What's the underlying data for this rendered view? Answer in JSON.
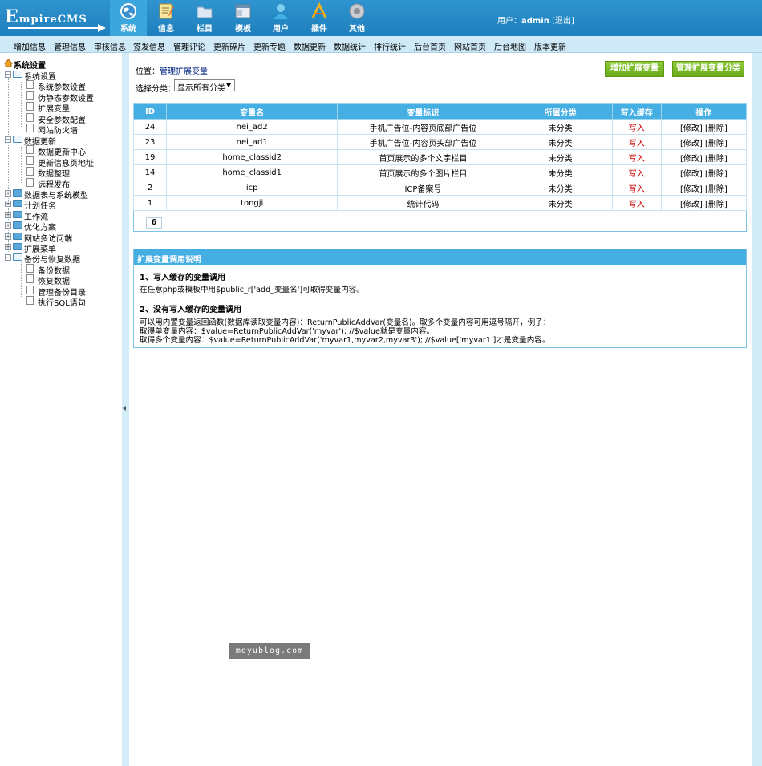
{
  "app": {
    "logo_text": "EmpireCMS"
  },
  "top_tabs": [
    {
      "label": "系统",
      "icon": "globe-icon"
    },
    {
      "label": "信息",
      "icon": "notepad-icon"
    },
    {
      "label": "栏目",
      "icon": "folder-icon"
    },
    {
      "label": "模板",
      "icon": "window-template-icon"
    },
    {
      "label": "用户",
      "icon": "user-icon"
    },
    {
      "label": "插件",
      "icon": "tools-icon"
    },
    {
      "label": "其他",
      "icon": "gear-icon"
    }
  ],
  "user": {
    "prefix": "用户：",
    "name": "admin",
    "logout": "[退出]"
  },
  "subnav": [
    "增加信息",
    "管理信息",
    "审核信息",
    "签发信息",
    "管理评论",
    "更新碎片",
    "更新专题",
    "数据更新",
    "数据统计",
    "排行统计",
    "后台首页",
    "网站首页",
    "后台地图",
    "版本更新"
  ],
  "tree": {
    "root": "系统设置",
    "nodes": [
      {
        "label": "系统设置",
        "type": "folder",
        "open": true
      },
      {
        "label": "系统参数设置",
        "type": "leaf"
      },
      {
        "label": "伪静态参数设置",
        "type": "leaf"
      },
      {
        "label": "扩展变量",
        "type": "leaf"
      },
      {
        "label": "安全参数配置",
        "type": "leaf"
      },
      {
        "label": "网站防火墙",
        "type": "leaf"
      },
      {
        "label": "数据更新",
        "type": "folder",
        "open": true
      },
      {
        "label": "数据更新中心",
        "type": "leaf"
      },
      {
        "label": "更新信息页地址",
        "type": "leaf"
      },
      {
        "label": "数据整理",
        "type": "leaf"
      },
      {
        "label": "远程发布",
        "type": "leaf"
      },
      {
        "label": "数据表与系统模型",
        "type": "folder",
        "open": false
      },
      {
        "label": "计划任务",
        "type": "folder",
        "open": false
      },
      {
        "label": "工作流",
        "type": "folder",
        "open": false
      },
      {
        "label": "优化方案",
        "type": "folder",
        "open": false
      },
      {
        "label": "网站多访问端",
        "type": "folder",
        "open": false
      },
      {
        "label": "扩展菜单",
        "type": "folder",
        "open": false
      },
      {
        "label": "备份与恢复数据",
        "type": "folder",
        "open": true
      },
      {
        "label": "备份数据",
        "type": "leaf"
      },
      {
        "label": "恢复数据",
        "type": "leaf"
      },
      {
        "label": "管理备份目录",
        "type": "leaf"
      },
      {
        "label": "执行SQL语句",
        "type": "leaf"
      }
    ]
  },
  "main": {
    "location_prefix": "位置：",
    "location_link": "管理扩展变量",
    "category_label": "选择分类：",
    "category_selected": "显示所有分类",
    "btn_add": "增加扩展变量",
    "btn_manage": "管理扩展变量分类",
    "table": {
      "headers": [
        "ID",
        "变量名",
        "变量标识",
        "所属分类",
        "写入缓存",
        "操作"
      ],
      "rows": [
        {
          "id": "24",
          "name": "nei_ad2",
          "label": "手机广告位-内容页底部广告位",
          "cat": "未分类",
          "cache": "写入",
          "ops": "[修改] [删除]"
        },
        {
          "id": "23",
          "name": "nei_ad1",
          "label": "手机广告位-内容页头部广告位",
          "cat": "未分类",
          "cache": "写入",
          "ops": "[修改] [删除]"
        },
        {
          "id": "19",
          "name": "home_classid2",
          "label": "首页展示的多个文字栏目",
          "cat": "未分类",
          "cache": "写入",
          "ops": "[修改] [删除]"
        },
        {
          "id": "14",
          "name": "home_classid1",
          "label": "首页展示的多个图片栏目",
          "cat": "未分类",
          "cache": "写入",
          "ops": "[修改] [删除]"
        },
        {
          "id": "2",
          "name": "icp",
          "label": "ICP备案号",
          "cat": "未分类",
          "cache": "写入",
          "ops": "[修改] [删除]"
        },
        {
          "id": "1",
          "name": "tongji",
          "label": "统计代码",
          "cat": "未分类",
          "cache": "写入",
          "ops": "[修改] [删除]"
        }
      ],
      "pager": "6"
    },
    "help": {
      "title": "扩展变量调用说明",
      "s1_title": "1、写入缓存的变量调用",
      "s1_line": "在任意php或模板中用$public_r['add_变量名']可取得变量内容。",
      "s2_title": "2、没有写入缓存的变量调用",
      "s2_lines": [
        "可以用内置变量返回函数(数据库读取变量内容)：ReturnPublicAddVar(变量名)。取多个变量内容可用逗号隔开，例子：",
        "取得单变量内容：$value=ReturnPublicAddVar('myvar'); //$value就是变量内容。",
        "取得多个变量内容：$value=ReturnPublicAddVar('myvar1,myvar2,myvar3'); //$value['myvar1']才是变量内容。"
      ]
    }
  },
  "watermark": "moyublog.com"
}
